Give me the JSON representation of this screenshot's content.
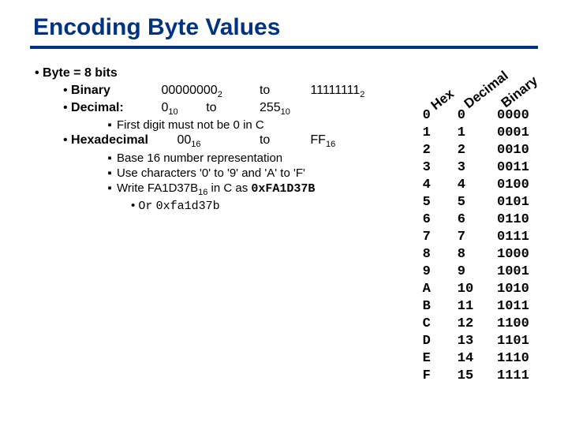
{
  "title": "Encoding Byte Values",
  "bits_line": "Byte = 8 bits",
  "binary": {
    "label": "Binary",
    "min_main": "00000000",
    "min_sub": "2",
    "to": "to",
    "max_main": "11111111",
    "max_sub": "2"
  },
  "decimal": {
    "label": "Decimal:",
    "min_main": "0",
    "min_sub": "10",
    "to": "to",
    "max_main": "255",
    "max_sub": "10",
    "note": "First digit must not be 0 in C"
  },
  "hex": {
    "label": "Hexadecimal",
    "min_main": "00",
    "min_sub": "16",
    "to": "to",
    "max_main": "FF",
    "max_sub": "16",
    "n1": "Base 16 number representation",
    "n2": "Use characters '0' to '9' and 'A' to 'F'",
    "n3_a": "Write FA1D37B",
    "n3_sub": "16",
    "n3_b": " in C as ",
    "n3_c": "0xFA1D37B",
    "or": "Or",
    "alt": "0xfa1d37b"
  },
  "headers": {
    "hex": "Hex",
    "dec": "Decimal",
    "bin": "Binary"
  },
  "chart_data": {
    "type": "table",
    "title": "Hex / Decimal / Binary",
    "columns": [
      "Hex",
      "Decimal",
      "Binary"
    ],
    "rows": [
      [
        "0",
        "0",
        "0000"
      ],
      [
        "1",
        "1",
        "0001"
      ],
      [
        "2",
        "2",
        "0010"
      ],
      [
        "3",
        "3",
        "0011"
      ],
      [
        "4",
        "4",
        "0100"
      ],
      [
        "5",
        "5",
        "0101"
      ],
      [
        "6",
        "6",
        "0110"
      ],
      [
        "7",
        "7",
        "0111"
      ],
      [
        "8",
        "8",
        "1000"
      ],
      [
        "9",
        "9",
        "1001"
      ],
      [
        "A",
        "10",
        "1010"
      ],
      [
        "B",
        "11",
        "1011"
      ],
      [
        "C",
        "12",
        "1100"
      ],
      [
        "D",
        "13",
        "1101"
      ],
      [
        "E",
        "14",
        "1110"
      ],
      [
        "F",
        "15",
        "1111"
      ]
    ]
  }
}
